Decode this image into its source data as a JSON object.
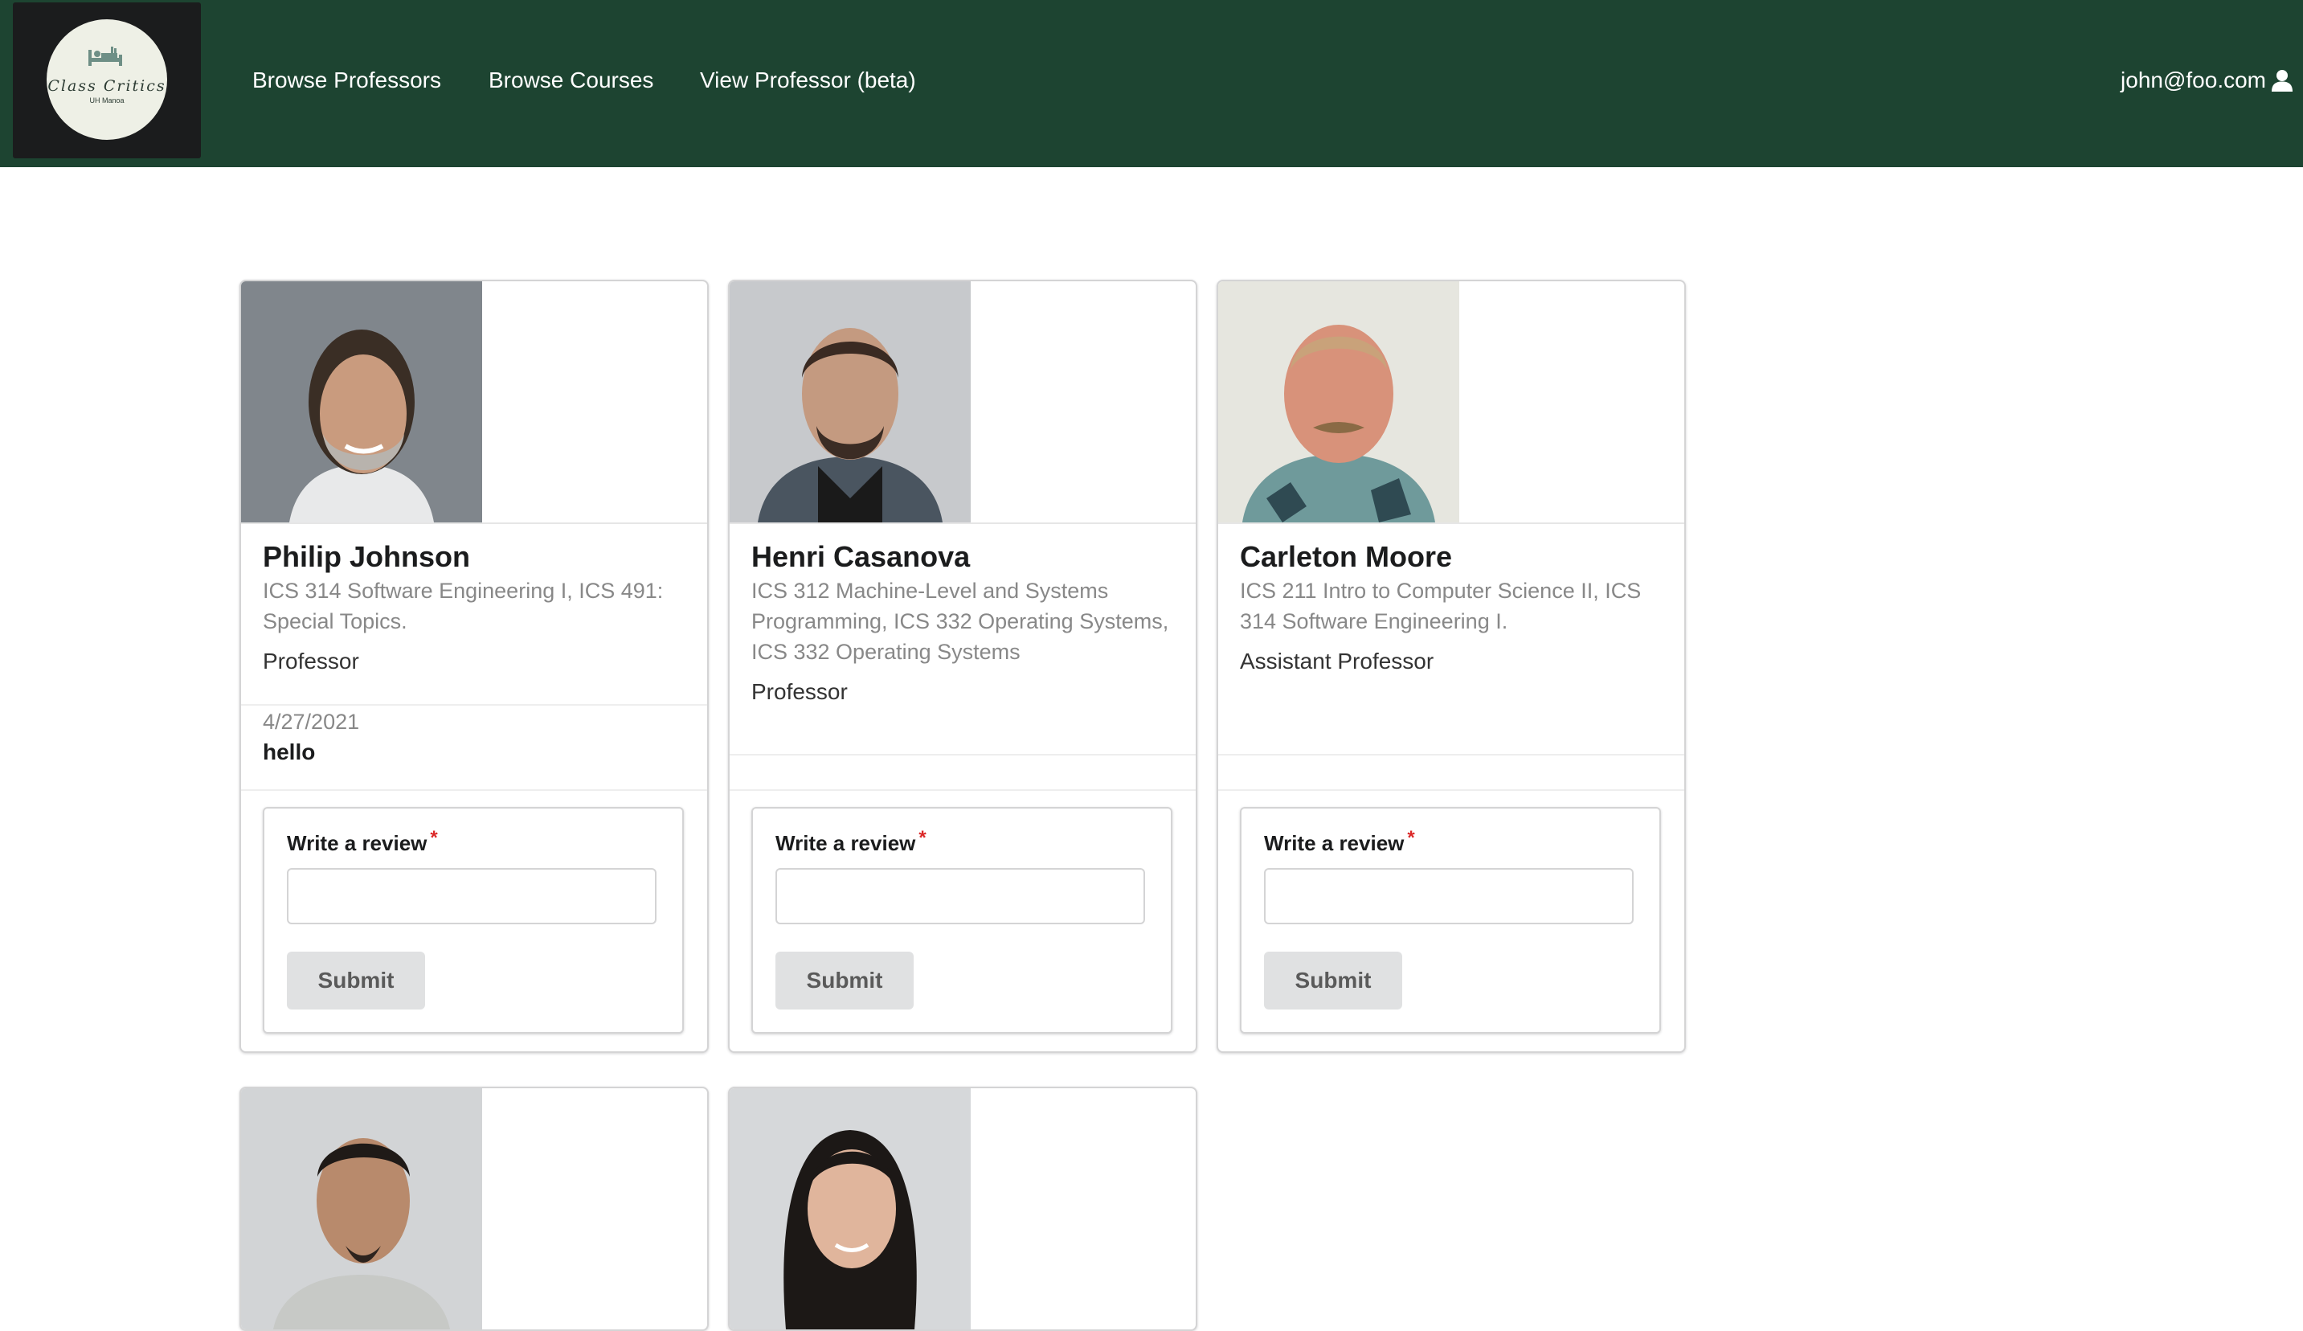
{
  "nav": {
    "logo_title": "Class Critics",
    "logo_subtitle": "UH Manoa",
    "links": [
      "Browse Professors",
      "Browse Courses",
      "View Professor (beta)"
    ],
    "user": "john@foo.com",
    "colors": {
      "navbar": "#1d4431",
      "logo_bg": "#1b1c1d"
    }
  },
  "professors": [
    {
      "name": "Philip Johnson",
      "courses": "ICS 314 Software Engineering I, ICS 491: Special Topics.",
      "title": "Professor",
      "review": {
        "date": "4/27/2021",
        "text": "hello"
      },
      "form": {
        "label": "Write a review",
        "required": "*",
        "value": "",
        "submit": "Submit"
      }
    },
    {
      "name": "Henri Casanova",
      "courses": "ICS 312 Machine-Level and Systems Programming, ICS 332 Operating Systems, ICS 332 Operating Systems",
      "title": "Professor",
      "form": {
        "label": "Write a review",
        "required": "*",
        "value": "",
        "submit": "Submit"
      }
    },
    {
      "name": "Carleton Moore",
      "courses": "ICS 211 Intro to Computer Science II, ICS 314 Software Engineering I.",
      "title": "Assistant Professor",
      "form": {
        "label": "Write a review",
        "required": "*",
        "value": "",
        "submit": "Submit"
      }
    }
  ],
  "icons": {
    "user": "user-icon",
    "logo": "logo-icon"
  }
}
